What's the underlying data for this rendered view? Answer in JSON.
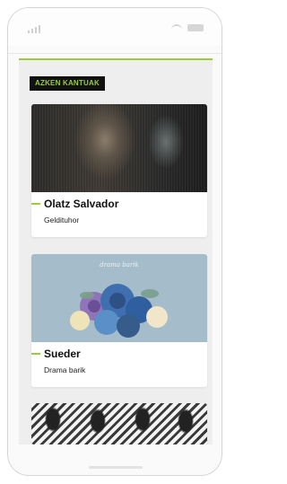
{
  "section": {
    "title": "AZKEN KANTUAK"
  },
  "songs": [
    {
      "artist": "Olatz Salvador",
      "title": "Geldituhor",
      "image": "portrait-photo"
    },
    {
      "artist": "Sueder",
      "title": "Drama barik",
      "image": "album-cover-roses",
      "cover_text": "drama barik"
    },
    {
      "artist": "",
      "title": "",
      "image": "band-photo"
    }
  ],
  "colors": {
    "accent": "#9ccd3b",
    "tag_bg": "#111111",
    "content_bg": "#eeeeee"
  }
}
